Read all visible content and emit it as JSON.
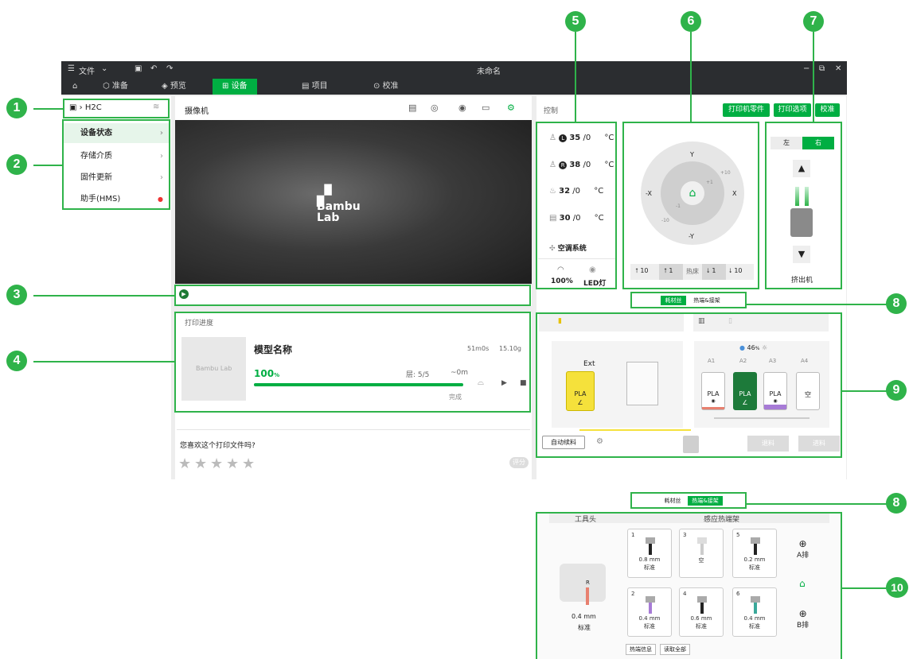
{
  "titlebar": {
    "file_menu": "文件",
    "title": "未命名"
  },
  "nav_tabs": [
    "准备",
    "预览",
    "设备",
    "项目",
    "校准"
  ],
  "device": {
    "name": "H2C"
  },
  "sidebar": {
    "items": [
      {
        "label": "设备状态"
      },
      {
        "label": "存储介质"
      },
      {
        "label": "固件更新"
      },
      {
        "label": "助手(HMS)"
      }
    ]
  },
  "camera": {
    "title": "摄像机",
    "logo_line1": "Bambu",
    "logo_line2": "Lab"
  },
  "progress": {
    "title": "打印进度",
    "model_name": "模型名称",
    "time": "51m0s",
    "weight": "15.10g",
    "percent_value": "100",
    "percent_unit": "%",
    "layer": "层:  5/5",
    "remaining": "~0m",
    "status": "完成",
    "fill_fraction": 1.0,
    "thumb_logo": "Bambu Lab"
  },
  "rating": {
    "question": "您喜欢这个打印文件吗?",
    "button": "评分",
    "stars": 5
  },
  "control": {
    "title": "控制",
    "buttons": {
      "parts": "打印机零件",
      "options": "打印选项",
      "calibrate": "校准"
    },
    "temps": [
      {
        "badge": "L",
        "value": "35",
        "target": "/0",
        "unit": "°C"
      },
      {
        "badge": "R",
        "value": "38",
        "target": "/0",
        "unit": "°C"
      },
      {
        "badge": "",
        "value": "32",
        "target": "/0",
        "unit": "°C"
      },
      {
        "badge": "",
        "value": "30",
        "target": "/0",
        "unit": "°C"
      }
    ],
    "aircon": "空调系统",
    "fan_speed": "100%",
    "led": "LED灯"
  },
  "jog": {
    "axis_y": "Y",
    "axis_neg_y": "-Y",
    "axis_x": "X",
    "axis_neg_x": "-X",
    "step_10": "+10",
    "step_1": "+1",
    "step_neg1": "-1",
    "step_neg10": "-10",
    "bed_label": "热床",
    "bed_up10": "10",
    "bed_up1": "1",
    "bed_down1": "1",
    "bed_down10": "10"
  },
  "extruder": {
    "left": "左",
    "right": "右",
    "label": "挤出机"
  },
  "tabs_filament": {
    "filament": "耗材丝",
    "hotend": "热端&接架"
  },
  "ams": {
    "humidity": "46",
    "humidity_unit": "%",
    "ext_label": "Ext",
    "ext_material": "PLA",
    "slots": [
      {
        "id": "A1",
        "material": "PLA",
        "color": "#ffffff",
        "bar": "#e8806f"
      },
      {
        "id": "A2",
        "material": "PLA",
        "color": "#1d7a3a",
        "bar": "#1d7a3a"
      },
      {
        "id": "A3",
        "material": "PLA",
        "color": "#ffffff",
        "bar": "#a77bd6"
      },
      {
        "id": "A4",
        "material": "空",
        "color": "#ffffff",
        "bar": "#ffffff"
      }
    ],
    "auto_refill": "自动续料",
    "unload": "退料",
    "load": "进料"
  },
  "hotend_rack": {
    "toolhead_title": "工具头",
    "rack_title": "感应热端架",
    "toolhead_nozzle": "R",
    "toolhead_size": "0.4 mm",
    "toolhead_type": "标准",
    "cards": [
      {
        "num": "1",
        "size": "0.8 mm",
        "type": "标准",
        "empty": false,
        "color": "#222"
      },
      {
        "num": "3",
        "size": "空",
        "type": "",
        "empty": true,
        "color": "#ccc"
      },
      {
        "num": "5",
        "size": "0.2 mm",
        "type": "标准",
        "empty": false,
        "color": "#222"
      },
      {
        "num": "2",
        "size": "0.4 mm",
        "type": "标准",
        "empty": false,
        "color": "#a77bd6"
      },
      {
        "num": "4",
        "size": "0.6 mm",
        "type": "标准",
        "empty": false,
        "color": "#222"
      },
      {
        "num": "6",
        "size": "0.4 mm",
        "type": "标准",
        "empty": false,
        "color": "#3aa89a"
      }
    ],
    "row_a": "A排",
    "row_b": "B排",
    "btn_info": "热端信息",
    "btn_read": "读取全部"
  },
  "callouts": [
    "1",
    "2",
    "3",
    "4",
    "5",
    "6",
    "7",
    "8",
    "9",
    "8",
    "10"
  ],
  "colors": {
    "accent": "#00ae42",
    "callout": "#2fb34a"
  }
}
